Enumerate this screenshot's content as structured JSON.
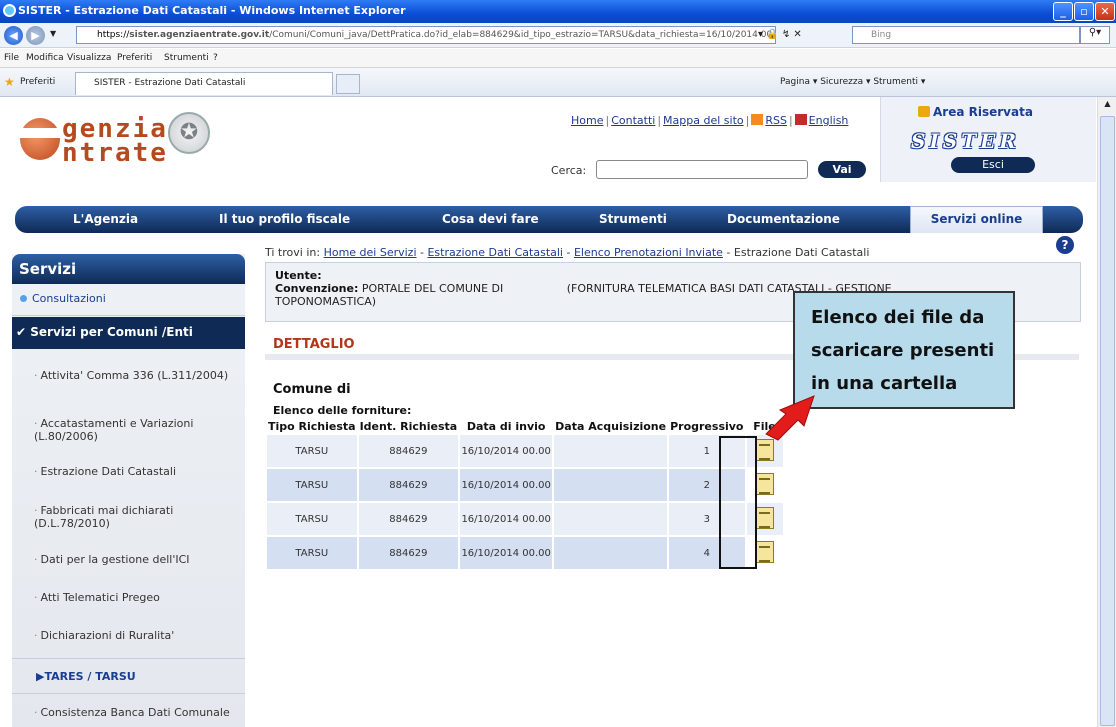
{
  "browser": {
    "title": "SISTER - Estrazione Dati Catastali - Windows Internet Explorer",
    "url_prefix": "https://",
    "url_host": "sister.agenziaentrate.gov.it",
    "url_rest": "/Comuni/Comuni_java/DettPratica.do?id_elab=884629&id_tipo_estrazio=TARSU&data_richiesta=16/10/2014 00.00",
    "search_placeholder": "Bing",
    "menu": [
      "File",
      "Modifica",
      "Visualizza",
      "Preferiti",
      "Strumenti",
      "?"
    ],
    "favorites_label": "Preferiti",
    "tab_title": "SISTER - Estrazione Dati Catastali",
    "command_bar": "Pagina ▾  Sicurezza ▾  Strumenti ▾"
  },
  "header": {
    "logo_line1": "genzia",
    "logo_line2": "ntrate",
    "links": [
      "Home",
      "Contatti",
      "Mappa del sito",
      "RSS",
      "English"
    ],
    "search_label": "Cerca:",
    "search_button": "Vai",
    "area_riservata": "Area Riservata",
    "sister_logo": "SISTER",
    "esci": "Esci"
  },
  "nav": {
    "items": [
      "L'Agenzia",
      "Il tuo profilo fiscale",
      "Cosa devi fare",
      "Strumenti",
      "Documentazione"
    ],
    "active": "Servizi online"
  },
  "breadcrumb": {
    "prefix": "Ti trovi in:",
    "links": [
      "Home dei Servizi",
      "Estrazione Dati Catastali",
      "Elenco Prenotazioni Inviate"
    ],
    "current": "Estrazione Dati Catastali"
  },
  "sidebar": {
    "title": "Servizi",
    "consultazioni": "Consultazioni",
    "servizi_comuni": "Servizi per Comuni /Enti",
    "items": [
      "Attivita' Comma 336 (L.311/2004)",
      "Accatastamenti e Variazioni (L.80/2006)",
      "Estrazione Dati Catastali",
      "Fabbricati mai dichiarati (D.L.78/2010)",
      "Dati per la gestione dell'ICI",
      "Atti Telematici Pregeo",
      "Dichiarazioni di Ruralita'"
    ],
    "tares": "TARES / TARSU",
    "last_item": "Consistenza Banca Dati Comunale"
  },
  "content": {
    "utente_label": "Utente:",
    "convenzione_label": "Convenzione:",
    "convenzione_text1": "PORTALE DEL COMUNE DI",
    "convenzione_text2": "(FORNITURA TELEMATICA BASI DATI CATASTALI - GESTIONE",
    "convenzione_text3": "TOPONOMASTICA)",
    "dettaglio": "DETTAGLIO",
    "comune_label": "Comune di",
    "elenco_label": "Elenco delle forniture:",
    "table": {
      "headers": [
        "Tipo Richiesta",
        "Ident. Richiesta",
        "Data di invio",
        "Data Acquisizione",
        "Progressivo",
        "File"
      ],
      "rows": [
        [
          "TARSU",
          "884629",
          "16/10/2014 00.00",
          "",
          "1"
        ],
        [
          "TARSU",
          "884629",
          "16/10/2014 00.00",
          "",
          "2"
        ],
        [
          "TARSU",
          "884629",
          "16/10/2014 00.00",
          "",
          "3"
        ],
        [
          "TARSU",
          "884629",
          "16/10/2014 00.00",
          "",
          "4"
        ]
      ]
    }
  },
  "callout": {
    "lines": [
      "Elenco dei file da",
      "scaricare presenti",
      "in una cartella"
    ]
  }
}
